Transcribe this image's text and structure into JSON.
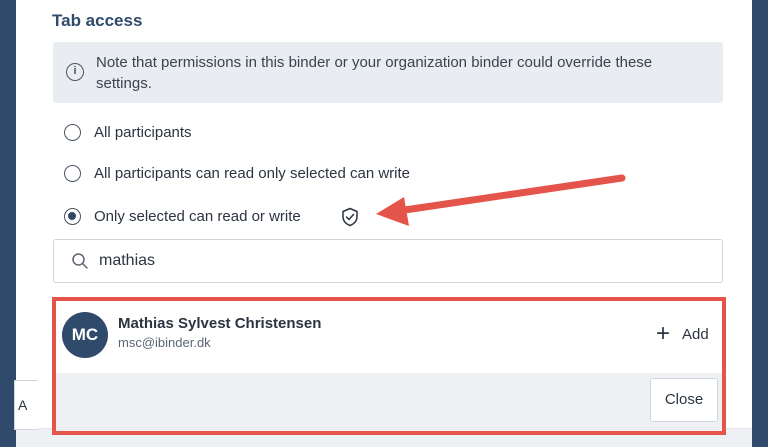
{
  "section": {
    "title": "Tab access"
  },
  "note": {
    "icon": "info-icon",
    "icon_glyph": "i",
    "text": "Note that permissions in this binder or your organization binder could override these settings."
  },
  "radio_options": [
    {
      "label": "All participants",
      "checked": false
    },
    {
      "label": "All participants can read only selected can write",
      "checked": false
    },
    {
      "label": "Only selected can read or write",
      "checked": true
    }
  ],
  "shield_icon": "shield-check-icon",
  "search": {
    "value": "mathias",
    "icon": "search-icon"
  },
  "result": {
    "initials": "MC",
    "name": "Mathias Sylvest Christensen",
    "email": "msc@ibinder.dk",
    "add_icon": "plus-icon",
    "add_symbol": "+",
    "add_label": "Add"
  },
  "footer": {
    "close_label": "Close"
  },
  "left_stub": {
    "text": "A"
  },
  "colors": {
    "navy": "#2f4a6b",
    "annotation": "#e4544a",
    "note_bg": "#e9ecf1"
  }
}
